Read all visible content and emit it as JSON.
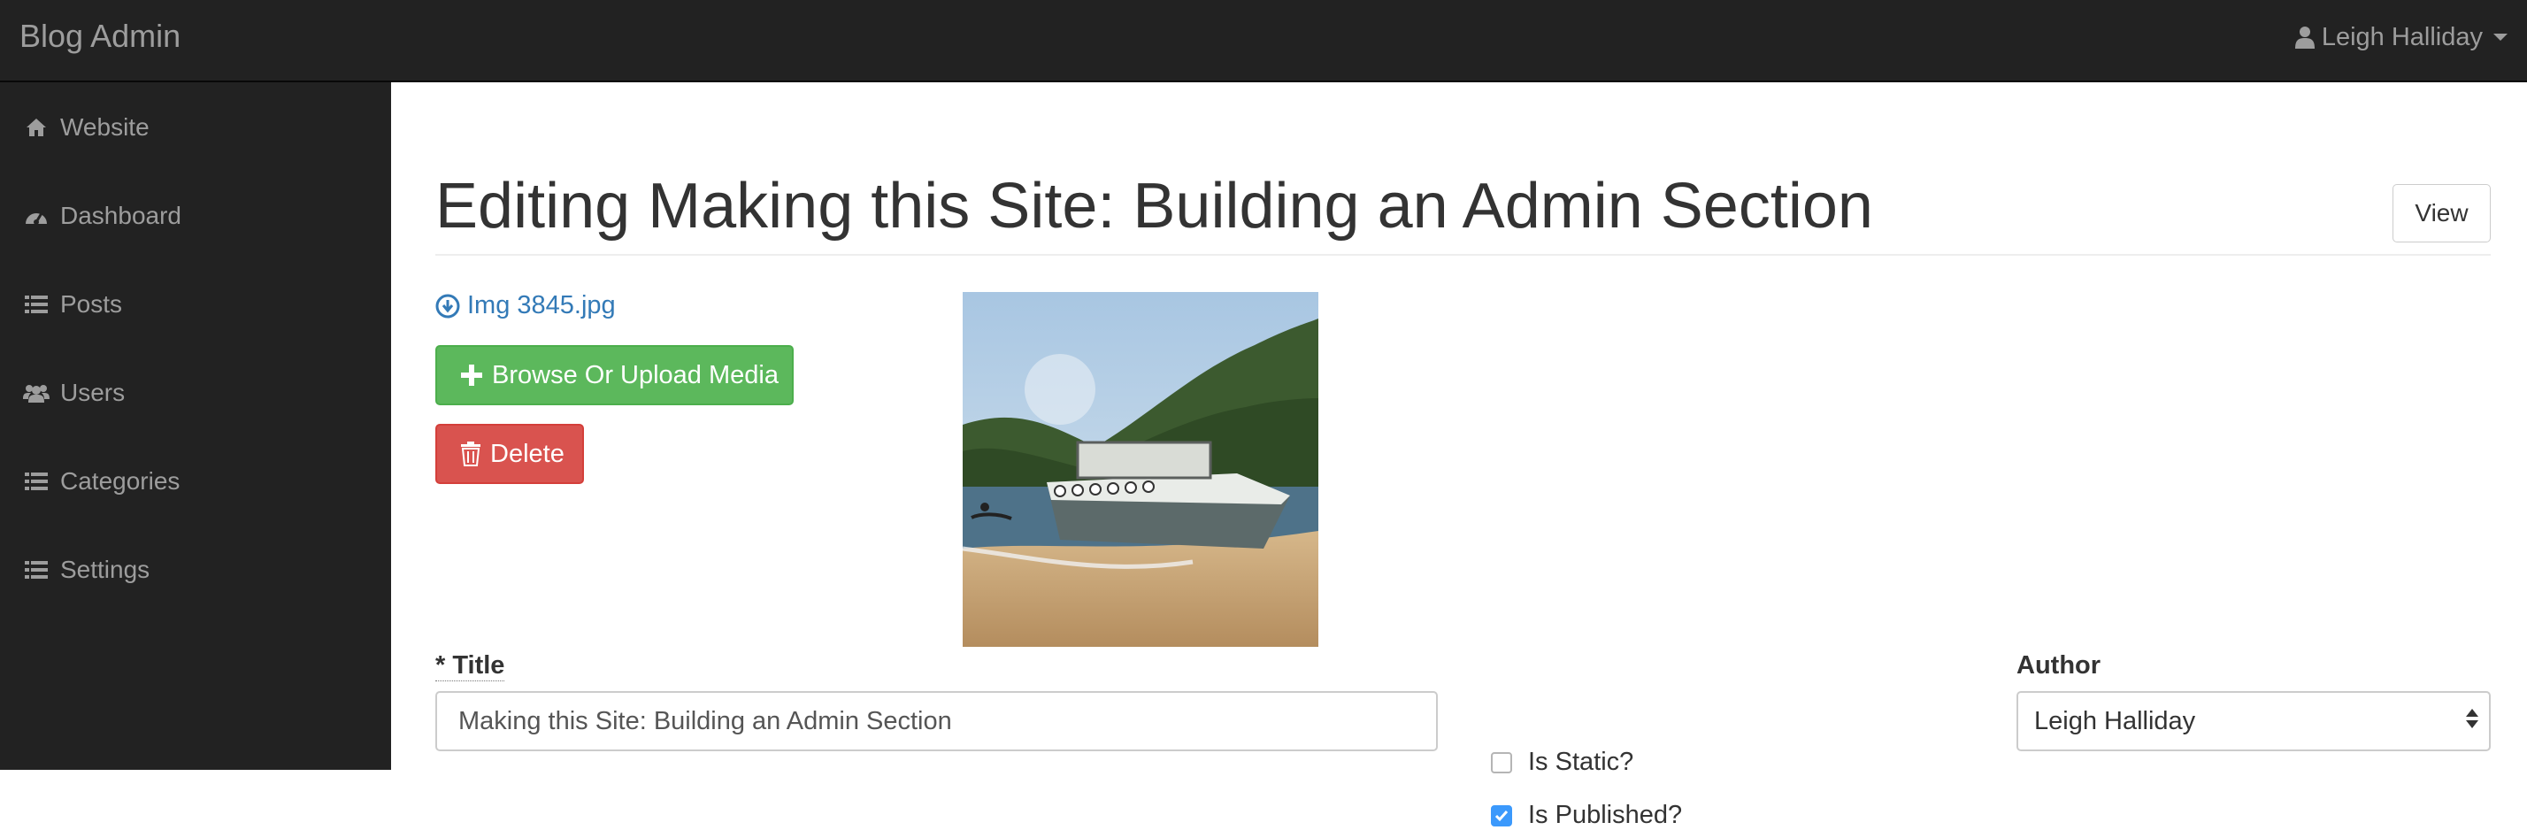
{
  "app": {
    "brand": "Blog Admin"
  },
  "user_menu": {
    "name": "Leigh Halliday",
    "icon": "user-icon"
  },
  "sidebar": {
    "items": [
      {
        "label": "Website",
        "icon": "home-icon"
      },
      {
        "label": "Dashboard",
        "icon": "dashboard-icon"
      },
      {
        "label": "Posts",
        "icon": "list-icon"
      },
      {
        "label": "Users",
        "icon": "users-icon"
      },
      {
        "label": "Categories",
        "icon": "list-icon"
      },
      {
        "label": "Settings",
        "icon": "list-icon"
      }
    ]
  },
  "page": {
    "title": "Editing Making this Site: Building an Admin Section",
    "view_label": "View"
  },
  "media": {
    "file_name": "Img 3845.jpg",
    "upload_label": "Browse Or Upload Media",
    "delete_label": "Delete"
  },
  "form": {
    "title_label": "* Title",
    "title_value": "Making this Site: Building an Admin Section",
    "is_static_label": "Is Static?",
    "is_static_checked": false,
    "is_published_label": "Is Published?",
    "is_published_checked": true,
    "author_label": "Author",
    "author_value": "Leigh Halliday"
  },
  "colors": {
    "navbar": "#222222",
    "link": "#337ab7",
    "success": "#5cb85c",
    "danger": "#d9534f",
    "checkbox_accent": "#3b99fc"
  }
}
